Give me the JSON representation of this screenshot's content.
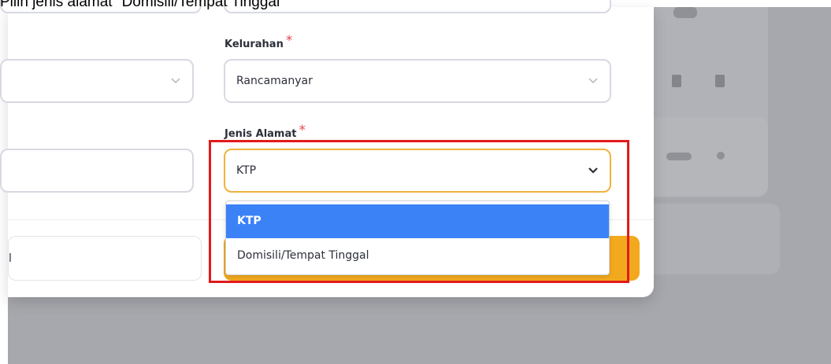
{
  "caption": "Pilih jenis alamat \"Domisili/Tempat Tinggal\"",
  "form": {
    "left_select": {
      "value": ""
    },
    "kelurahan": {
      "label": "Kelurahan",
      "required_mark": "*",
      "value": "Rancamanyar"
    },
    "left_input": {
      "value": ""
    },
    "jenis_alamat": {
      "label": "Jenis Alamat",
      "required_mark": "*",
      "value": "KTP",
      "options": [
        "KTP",
        "Domisili/Tempat Tinggal"
      ],
      "selected_index": 0
    }
  },
  "footer": {
    "left_button_label": "l",
    "right_button_label": ""
  },
  "colors": {
    "accent": "#f2a91e",
    "focus_border": "#f0b23c",
    "selected_option": "#3b82f6",
    "required": "#e5484d",
    "highlight_box": "#e11b1b"
  }
}
